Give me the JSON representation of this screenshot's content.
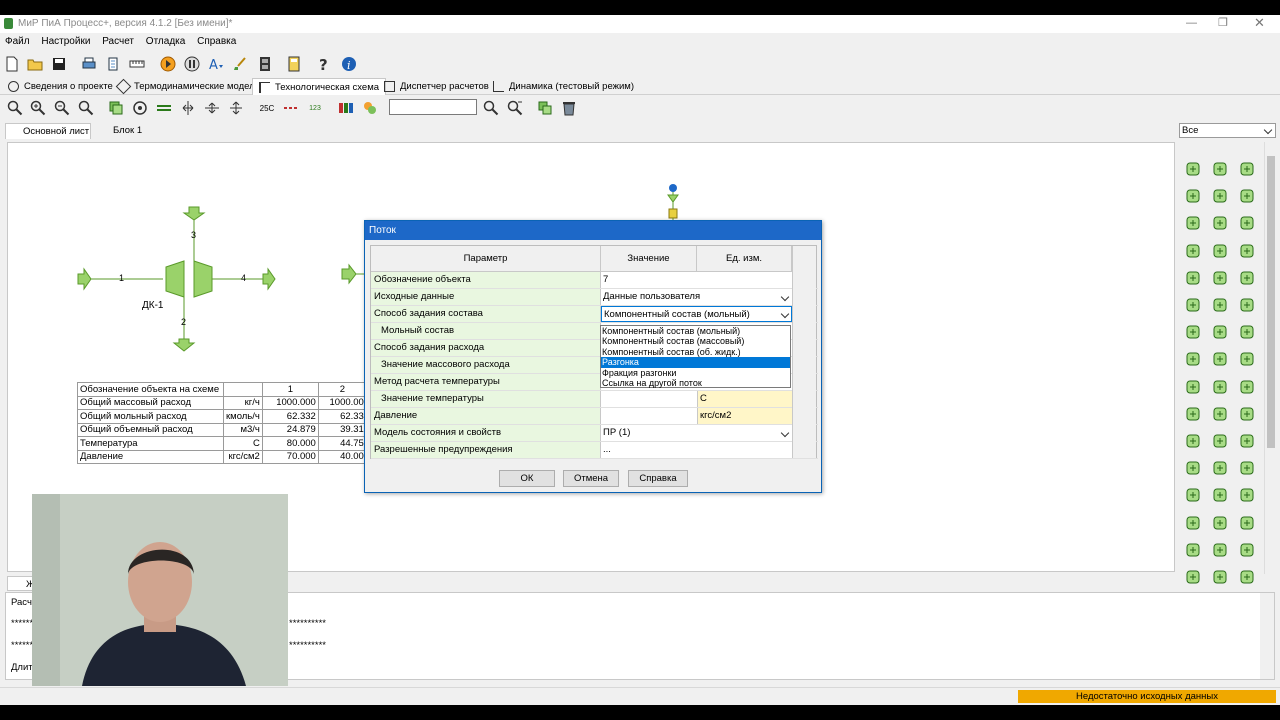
{
  "app": {
    "title": "МиР ПиА Процесс+, версия 4.1.2 [Без имени]*"
  },
  "menu": [
    "Файл",
    "Настройки",
    "Расчет",
    "Отладка",
    "Справка"
  ],
  "main_tabs": [
    {
      "label": "Сведения о проекте",
      "icon": "info-icon"
    },
    {
      "label": "Термодинамические модели",
      "icon": "model-icon"
    },
    {
      "label": "Технологическая схема",
      "icon": "scheme-icon"
    },
    {
      "label": "Диспетчер расчетов",
      "icon": "calc-icon"
    },
    {
      "label": "Динамика (тестовый режим)",
      "icon": "dynamics-icon"
    }
  ],
  "toolbar2": {
    "temp_label": "25C",
    "counter_label": "123"
  },
  "sheet_tabs": [
    "Основной лист",
    "Блок 1"
  ],
  "palette_filter": "Все",
  "scheme": {
    "unit_label": "ДК-1",
    "stream_labels": [
      "1",
      "2",
      "3",
      "4"
    ]
  },
  "stream_table": {
    "header": [
      "Обозначение объекта на схеме",
      "",
      "1",
      "2"
    ],
    "rows": [
      [
        "Общий массовый расход",
        "кг/ч",
        "1000.000",
        "1000.00"
      ],
      [
        "Общий мольный расход",
        "кмоль/ч",
        "62.332",
        "62.33"
      ],
      [
        "Общий объемный расход",
        "м3/ч",
        "24.879",
        "39.31"
      ],
      [
        "Температура",
        "С",
        "80.000",
        "44.75"
      ],
      [
        "Давление",
        "кгс/см2",
        "70.000",
        "40.00"
      ]
    ]
  },
  "log": {
    "tab_label": "Ж",
    "lines": [
      "Расч",
      "**********",
      "**********",
      "Длит"
    ],
    "stars_right": "**********"
  },
  "status": {
    "warning": "Недостаточно исходных данных",
    "warning_color": "#f0a800"
  },
  "dialog": {
    "title": "Поток",
    "headers": [
      "Параметр",
      "Значение",
      "Ед. изм."
    ],
    "rows": [
      {
        "param": "Обозначение объекта",
        "value": "7",
        "unit": ""
      },
      {
        "param": "Исходные данные",
        "value": "Данные пользователя",
        "unit": ""
      },
      {
        "param": "Способ задания состава",
        "value": "Компонентный состав (мольный)",
        "unit": ""
      },
      {
        "param": "Мольный состав",
        "value": "",
        "unit": ""
      },
      {
        "param": "Способ задания расхода",
        "value": "",
        "unit": ""
      },
      {
        "param": "Значение массового расхода",
        "value": "",
        "unit": ""
      },
      {
        "param": "Метод расчета температуры",
        "value": "",
        "unit": ""
      },
      {
        "param": "Значение температуры",
        "value": "",
        "unit": "С"
      },
      {
        "param": "Давление",
        "value": "",
        "unit": "кгс/см2"
      },
      {
        "param": "Модель состояния и свойств",
        "value": "ПР (1)",
        "unit": ""
      },
      {
        "param": "Разрешенные предупреждения",
        "value": "...",
        "unit": ""
      }
    ],
    "dropdown_options": [
      "Компонентный состав (мольный)",
      "Компонентный состав (массовый)",
      "Компонентный состав (об. жидк.)",
      "Разгонка",
      "Фракция разгонки",
      "Ссылка на другой поток"
    ],
    "dropdown_selected": "Разгонка",
    "buttons": {
      "ok": "ОК",
      "cancel": "Отмена",
      "help": "Справка"
    }
  }
}
